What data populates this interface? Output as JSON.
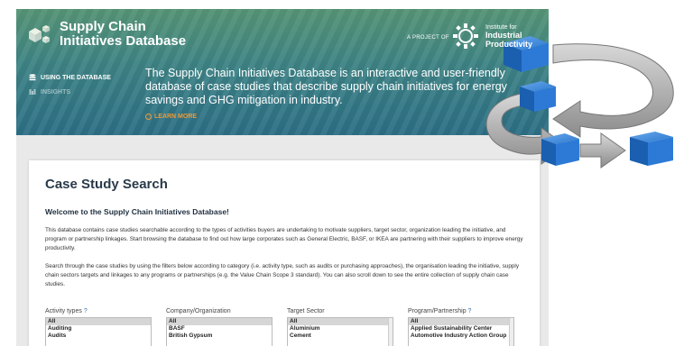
{
  "header": {
    "title_line1": "Supply Chain",
    "title_line2": "Initiatives Database",
    "project_of": "A PROJECT OF",
    "partner_line1": "Institute for",
    "partner_line2": "Industrial",
    "partner_line3": "Productivity"
  },
  "nav": {
    "using": "USING THE DATABASE",
    "insights": "INSIGHTS"
  },
  "intro": "The Supply Chain Initiatives Database is an interactive and user-friendly database of case studies that describe supply chain initiatives for energy savings and GHG mitigation in industry.",
  "learn_more": "LEARN MORE",
  "card": {
    "title": "Case Study Search",
    "welcome": "Welcome to the Supply Chain Initiatives Database!",
    "para1": "This database contains case studies searchable according to the types of activities buyers are undertaking to motivate suppliers, target sector, organization leading the initiative, and program or partnership linkages. Start browsing the database to find out how large corporates such as General Electric, BASF, or IKEA are partnering with their suppliers to improve energy productivity.",
    "para2": "Search through the case studies by using the filters below according to category (i.e. activity type, such as audits or purchasing approaches), the organisation leading the initiative, supply chain sectors targets and linkages to any programs or partnerships (e.g. the Value Chain Scope 3 standard). You can also scroll down to see the entire collection of supply chain case studies."
  },
  "filters": [
    {
      "label": "Activity types",
      "help": "?",
      "options": [
        "All",
        "Auditing",
        "Audits"
      ]
    },
    {
      "label": "Company/Organization",
      "help": "",
      "options": [
        "All",
        "BASF",
        "British Gypsum"
      ]
    },
    {
      "label": "Target Sector",
      "help": "",
      "options": [
        "All",
        "Aluminium",
        "Cement"
      ]
    },
    {
      "label": "Program/Partnership",
      "help": "?",
      "options": [
        "All",
        "Applied Sustainability Center",
        "Automotive Industry Action Group"
      ]
    }
  ],
  "colors": {
    "banner": "#3f8585",
    "accent": "#f29a33",
    "cube": "#1f6fc9",
    "arrow": "#a8a8a8"
  }
}
